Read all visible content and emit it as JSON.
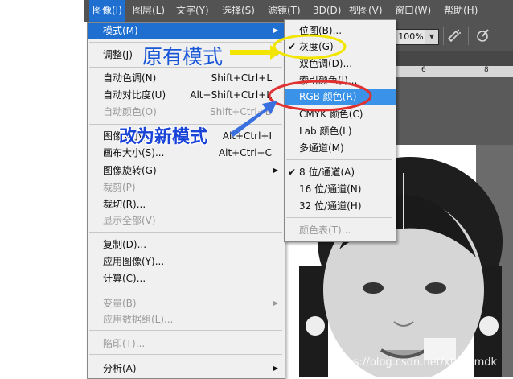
{
  "menubar": {
    "items": [
      "图像(I)",
      "图层(L)",
      "文字(Y)",
      "选择(S)",
      "滤镜(T)",
      "3D(D)",
      "视图(V)",
      "窗口(W)",
      "帮助(H)"
    ]
  },
  "toolbar": {
    "zoom": "100%",
    "zoom_arrow_icon": "chevron-down-icon",
    "icons": [
      "airbrush-icon",
      "pressure-icon"
    ]
  },
  "ruler": {
    "ticks": [
      "6",
      "8"
    ]
  },
  "image_menu": {
    "items": [
      {
        "label": "模式(M)",
        "submenu": true,
        "highlighted": true
      },
      {
        "label": "调整(J)",
        "submenu": true
      },
      {
        "label": "自动色调(N)",
        "shortcut": "Shift+Ctrl+L"
      },
      {
        "label": "自动对比度(U)",
        "shortcut": "Alt+Shift+Ctrl+L"
      },
      {
        "label": "自动颜色(O)",
        "shortcut": "Shift+Ctrl+B",
        "disabled": true
      },
      {
        "label": "图像大小(I)...",
        "shortcut": "Alt+Ctrl+I"
      },
      {
        "label": "画布大小(S)...",
        "shortcut": "Alt+Ctrl+C"
      },
      {
        "label": "图像旋转(G)",
        "submenu": true
      },
      {
        "label": "裁剪(P)",
        "disabled": true
      },
      {
        "label": "裁切(R)..."
      },
      {
        "label": "显示全部(V)",
        "disabled": true
      },
      {
        "label": "复制(D)..."
      },
      {
        "label": "应用图像(Y)..."
      },
      {
        "label": "计算(C)..."
      },
      {
        "label": "变量(B)",
        "submenu": true,
        "disabled": true
      },
      {
        "label": "应用数据组(L)...",
        "disabled": true
      },
      {
        "label": "陷印(T)...",
        "disabled": true
      },
      {
        "label": "分析(A)",
        "submenu": true
      }
    ]
  },
  "mode_submenu": {
    "items": [
      {
        "label": "位图(B)..."
      },
      {
        "label": "灰度(G)",
        "checked": true
      },
      {
        "label": "双色调(D)..."
      },
      {
        "label": "索引颜色(I)..."
      },
      {
        "label": "RGB 颜色(R)",
        "highlighted": true
      },
      {
        "label": "CMYK 颜色(C)"
      },
      {
        "label": "Lab 颜色(L)"
      },
      {
        "label": "多通道(M)"
      },
      {
        "label": "8 位/通道(A)",
        "checked": true
      },
      {
        "label": "16 位/通道(N)"
      },
      {
        "label": "32 位/通道(H)"
      },
      {
        "label": "颜色表(T)...",
        "disabled": true
      }
    ]
  },
  "annotations": {
    "original_mode": "原有模式",
    "change_mode": "改为新模式",
    "colors": {
      "annotation_blue": "#1a57d6",
      "circle_yellow": "#f2e600",
      "circle_red": "#e03030"
    }
  },
  "watermark": "https://blog.csdn.net/xtggbmdk"
}
